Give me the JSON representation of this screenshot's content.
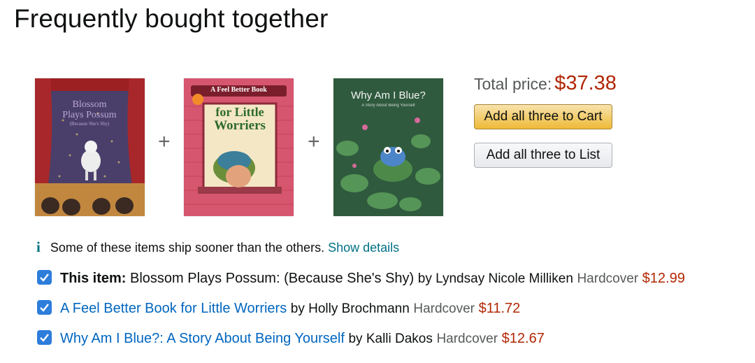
{
  "section": {
    "title": "Frequently bought together"
  },
  "bundle": {
    "covers": [
      {
        "title_line1": "Blossom",
        "title_line2": "Plays Possum",
        "title_line3": "(Because She's Shy)"
      },
      {
        "banner": "A Feel Better Book",
        "title_line1": "for Little",
        "title_line2": "Worriers"
      },
      {
        "title_line1": "Why Am I Blue?",
        "subtitle": "A Story About Being Yourself"
      }
    ],
    "plus_sign": "+",
    "total_label": "Total price:",
    "total_price": "$37.38",
    "add_cart_label": "Add all three to Cart",
    "add_list_label": "Add all three to List"
  },
  "notice": {
    "icon": "i",
    "text": "Some of these items ship sooner than the others.",
    "link": "Show details"
  },
  "items": [
    {
      "checked": true,
      "prefix": "This item:",
      "title": "Blossom Plays Possum: (Because She's Shy)",
      "author": "by Lyndsay Nicole Milliken",
      "format": "Hardcover",
      "price": "$12.99"
    },
    {
      "checked": true,
      "title": "A Feel Better Book for Little Worriers",
      "author": "by Holly Brochmann",
      "format": "Hardcover",
      "price": "$11.72"
    },
    {
      "checked": true,
      "title": "Why Am I Blue?: A Story About Being Yourself",
      "author": "by Kalli Dakos",
      "format": "Hardcover",
      "price": "$12.67"
    }
  ],
  "colors": {
    "price": "#b12704",
    "link": "#007185",
    "cart_button": "#f0c14b",
    "checkbox": "#2d7ddb"
  }
}
